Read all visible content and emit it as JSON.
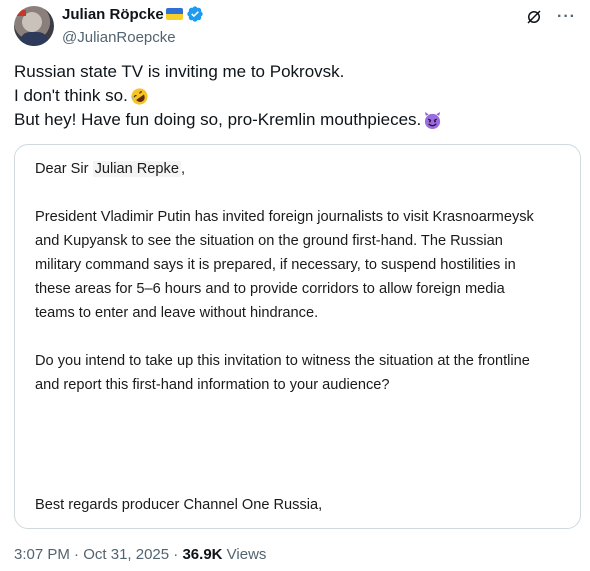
{
  "author": {
    "display_name": "Julian Röpcke",
    "handle": "@JulianRoepcke",
    "flag_icon": "ukraine-flag-icon",
    "verified_icon": "verified-badge-icon",
    "verified_color": "#1d9bf0"
  },
  "tweet": {
    "line1": "Russian state TV is inviting me to Pokrovsk.",
    "line2": "I don't think so.",
    "line2_emoji": "rolling-on-floor-laughing-emoji",
    "line3": "But hey! Have fun doing so, pro-Kremlin mouthpieces.",
    "line3_emoji": "smiling-devil-emoji"
  },
  "letter": {
    "salutation_prefix": "Dear Sir ",
    "salutation_name": "Julian Repke",
    "salutation_suffix": ",",
    "para1_l1": "President Vladimir Putin has invited foreign journalists to visit Krasnoarmeysk",
    "para1_l2": "and Kupyansk to see the situation on the ground first-hand. The Russian",
    "para1_l3": "military command says it is prepared, if necessary, to suspend hostilities in",
    "para1_l4": "these areas for 5–6 hours and to provide corridors to allow foreign media",
    "para1_l5": "teams to enter and leave without hindrance.",
    "para2_l1": "Do you intend to take up this invitation to witness the situation at the frontline",
    "para2_l2": "and report this first-hand information to your audience?",
    "closing": "Best regards producer Channel One Russia,"
  },
  "meta": {
    "time": "3:07 PM",
    "separator": " · ",
    "date": "Oct 31, 2025",
    "separator2": " · ",
    "views_count": "36.9K",
    "views_label": " Views"
  },
  "header_actions": {
    "grok_icon": "grok-icon",
    "more_icon": "more-options-icon",
    "more_glyph": "···"
  }
}
